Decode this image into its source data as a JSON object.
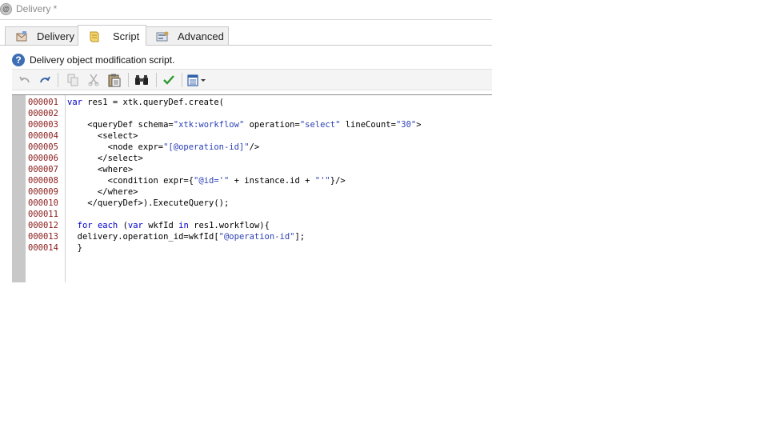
{
  "window": {
    "title": "Delivery *"
  },
  "tabs": [
    {
      "label": "Delivery",
      "icon": "delivery-icon",
      "active": false
    },
    {
      "label": "Script",
      "icon": "script-icon",
      "active": true
    },
    {
      "label": "Advanced",
      "icon": "advanced-icon",
      "active": false
    }
  ],
  "description": {
    "text": "Delivery object modification script.",
    "icon": "help-icon"
  },
  "toolbar": {
    "buttons": [
      "undo",
      "redo",
      "copy",
      "cut",
      "paste",
      "find",
      "check-syntax",
      "insert-menu"
    ]
  },
  "editor": {
    "line_numbers": [
      "000001",
      "000002",
      "000003",
      "000004",
      "000005",
      "000006",
      "000007",
      "000008",
      "000009",
      "000010",
      "000011",
      "000012",
      "000013",
      "000014"
    ],
    "lines": [
      "var res1 = xtk.queryDef.create(",
      "",
      "    <queryDef schema=\"xtk:workflow\" operation=\"select\" lineCount=\"30\">",
      "      <select>",
      "        <node expr=\"[@operation-id]\"/>",
      "      </select>",
      "      <where>",
      "        <condition expr={\"@id='\" + instance.id + \"'\"}/>",
      "      </where>",
      "    </queryDef>).ExecuteQuery();",
      "",
      "  for each (var wkfId in res1.workflow){",
      "  delivery.operation_id=wkfId[\"@operation-id\"];",
      "  }"
    ]
  },
  "colors": {
    "keyword": "#0000cc",
    "string": "#2b3fb5",
    "line_number": "#8b1a1a",
    "gutter": "#c8c8c8"
  }
}
